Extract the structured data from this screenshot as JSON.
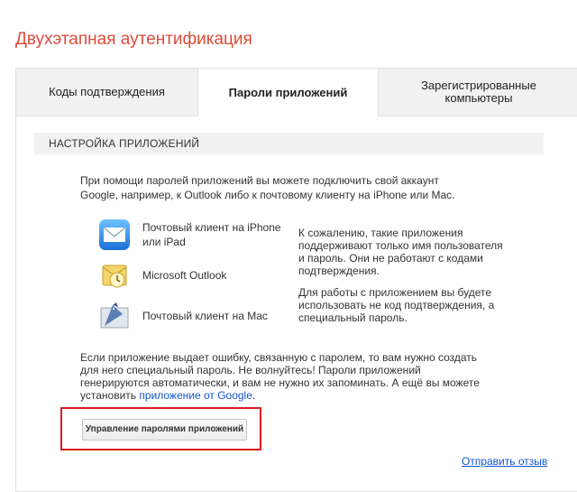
{
  "page": {
    "title": "Двухэтапная аутентификация"
  },
  "tabs": [
    {
      "label": "Коды подтверждения"
    },
    {
      "label": "Пароли приложений"
    },
    {
      "label": "Зарегистрированные компьютеры"
    }
  ],
  "section": {
    "header": "НАСТРОЙКА ПРИЛОЖЕНИЙ"
  },
  "intro": "При помощи паролей приложений вы можете подключить свой аккаунт Google, например, к Outlook либо к почтовому клиенту на iPhone или Mac.",
  "clients": [
    {
      "label": "Почтовый клиент на iPhone или iPad",
      "icon": "ios-mail-icon"
    },
    {
      "label": "Microsoft Outlook",
      "icon": "outlook-icon"
    },
    {
      "label": "Почтовый клиент на Mac",
      "icon": "mac-mail-icon"
    }
  ],
  "notes": [
    "К сожалению, такие приложения поддерживают только имя пользователя и пароль. Они не работают с кодами подтверждения.",
    "Для работы с приложением вы будете использовать не код подтверждения, а специальный пароль."
  ],
  "warning": {
    "text": "Если приложение выдает ошибку, связанную с паролем, то вам нужно создать для него специальный пароль. Не волнуйтесь! Пароли приложений генерируются автоматически, и вам не нужно их запоминать. А ещё вы можете установить ",
    "link": "приложение от Google",
    "end": "."
  },
  "buttons": {
    "manage": "Управление паролями приложений"
  },
  "feedback": "Отправить отзыв",
  "colors": {
    "title": "#dd4b39",
    "link": "#1155cc",
    "highlight": "#d6201f"
  }
}
